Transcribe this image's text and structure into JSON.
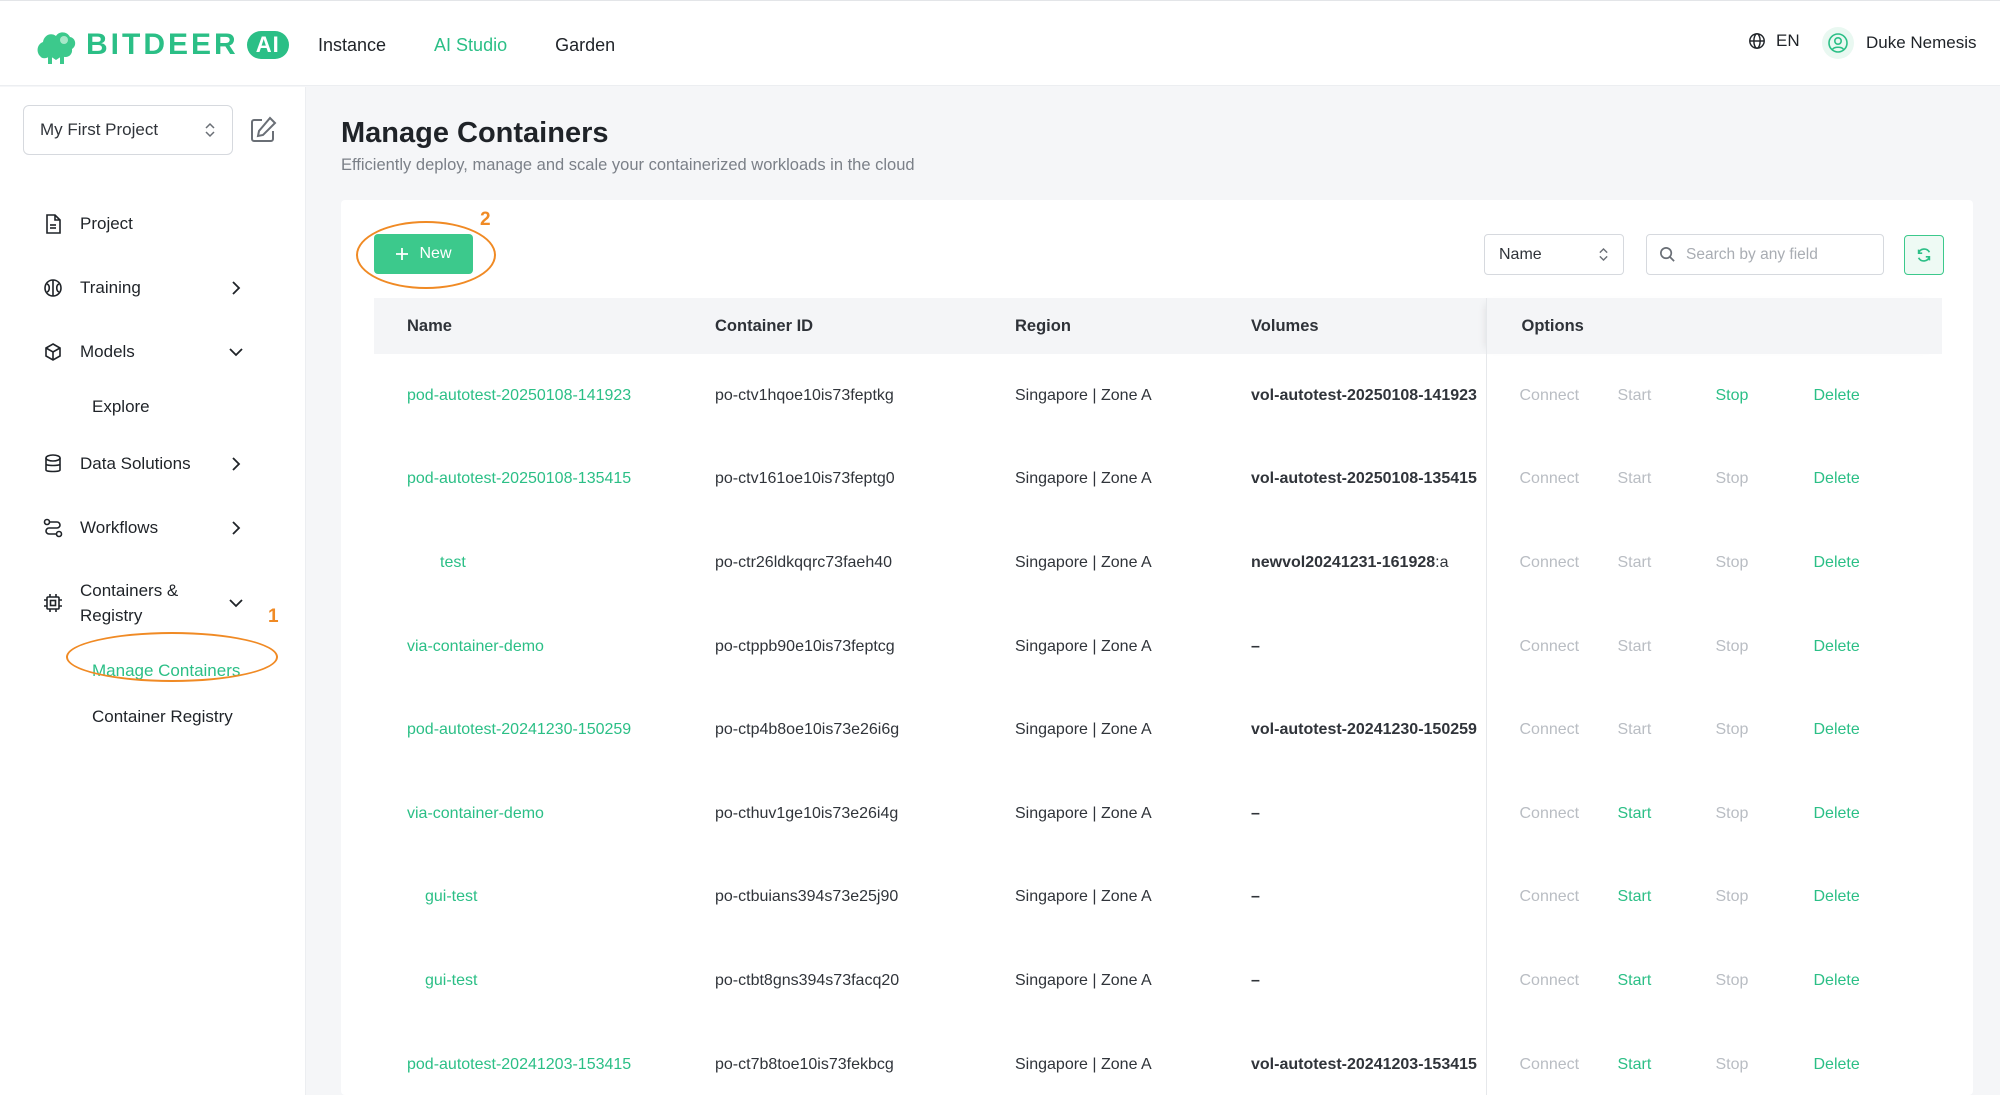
{
  "brand": {
    "name": "BITDEER",
    "badge": "AI"
  },
  "nav": {
    "items": [
      {
        "label": "Instance",
        "active": false
      },
      {
        "label": "AI Studio",
        "active": true
      },
      {
        "label": "Garden",
        "active": false
      }
    ]
  },
  "header": {
    "lang": "EN",
    "user_name": "Duke Nemesis"
  },
  "sidebar": {
    "project_select": "My First Project",
    "items": {
      "project": "Project",
      "training": "Training",
      "models": "Models",
      "models_explore": "Explore",
      "data_solutions": "Data Solutions",
      "workflows": "Workflows",
      "containers_line1": "Containers &",
      "containers_line2": "Registry",
      "manage_containers": "Manage Containers",
      "container_registry": "Container Registry"
    }
  },
  "annotations": {
    "one": "1",
    "two": "2"
  },
  "page": {
    "title": "Manage Containers",
    "subtitle": "Efficiently deploy, manage and scale your containerized workloads in the cloud"
  },
  "toolbar": {
    "new_label": "New",
    "field_select": "Name",
    "search_placeholder": "Search by any field"
  },
  "table": {
    "headers": {
      "name": "Name",
      "id": "Container ID",
      "region": "Region",
      "volumes": "Volumes",
      "options": "Options"
    },
    "option_labels": {
      "connect": "Connect",
      "start": "Start",
      "stop": "Stop",
      "delete": "Delete"
    },
    "rows": [
      {
        "name": "pod-autotest-20250108-141923",
        "id": "po-ctv1hqoe10is73feptkg",
        "region": "Singapore | Zone A",
        "volume": "vol-autotest-20250108-141923",
        "volume_suffix": "",
        "start_enabled": false,
        "stop_enabled": true
      },
      {
        "name": "pod-autotest-20250108-135415",
        "id": "po-ctv161oe10is73feptg0",
        "region": "Singapore | Zone A",
        "volume": "vol-autotest-20250108-135415",
        "volume_suffix": "",
        "start_enabled": false,
        "stop_enabled": false
      },
      {
        "name": "test",
        "id": "po-ctr26ldkqqrc73faeh40",
        "region": "Singapore | Zone A",
        "volume": "newvol20241231-161928",
        "volume_suffix": ":a",
        "start_enabled": false,
        "stop_enabled": false
      },
      {
        "name": "via-container-demo",
        "id": "po-ctppb90e10is73feptcg",
        "region": "Singapore | Zone A",
        "volume": "–",
        "volume_suffix": "",
        "start_enabled": false,
        "stop_enabled": false
      },
      {
        "name": "pod-autotest-20241230-150259",
        "id": "po-ctp4b8oe10is73e26i6g",
        "region": "Singapore | Zone A",
        "volume": "vol-autotest-20241230-150259",
        "volume_suffix": "",
        "start_enabled": false,
        "stop_enabled": false
      },
      {
        "name": "via-container-demo",
        "id": "po-cthuv1ge10is73e26i4g",
        "region": "Singapore | Zone A",
        "volume": "–",
        "volume_suffix": "",
        "start_enabled": true,
        "stop_enabled": false
      },
      {
        "name": "gui-test",
        "id": "po-ctbuians394s73e25j90",
        "region": "Singapore | Zone A",
        "volume": "–",
        "volume_suffix": "",
        "start_enabled": true,
        "stop_enabled": false
      },
      {
        "name": "gui-test",
        "id": "po-ctbt8gns394s73facq20",
        "region": "Singapore | Zone A",
        "volume": "–",
        "volume_suffix": "",
        "start_enabled": true,
        "stop_enabled": false
      },
      {
        "name": "pod-autotest-20241203-153415",
        "id": "po-ct7b8toe10is73fekbcg",
        "region": "Singapore | Zone A",
        "volume": "vol-autotest-20241203-153415",
        "volume_suffix": "",
        "start_enabled": true,
        "stop_enabled": false
      }
    ]
  },
  "colors": {
    "accent": "#2bbf86",
    "button": "#3cc98c",
    "annotation": "#f08a24",
    "disabled": "#b9bdc3"
  },
  "icons": {
    "logo": "bitdeer-logo-icon",
    "globe": "globe-icon",
    "user": "user-circle-icon",
    "edit": "edit-icon",
    "updown": "chevron-up-down-icon",
    "search": "search-icon",
    "refresh": "refresh-icon",
    "plus": "plus-icon"
  }
}
